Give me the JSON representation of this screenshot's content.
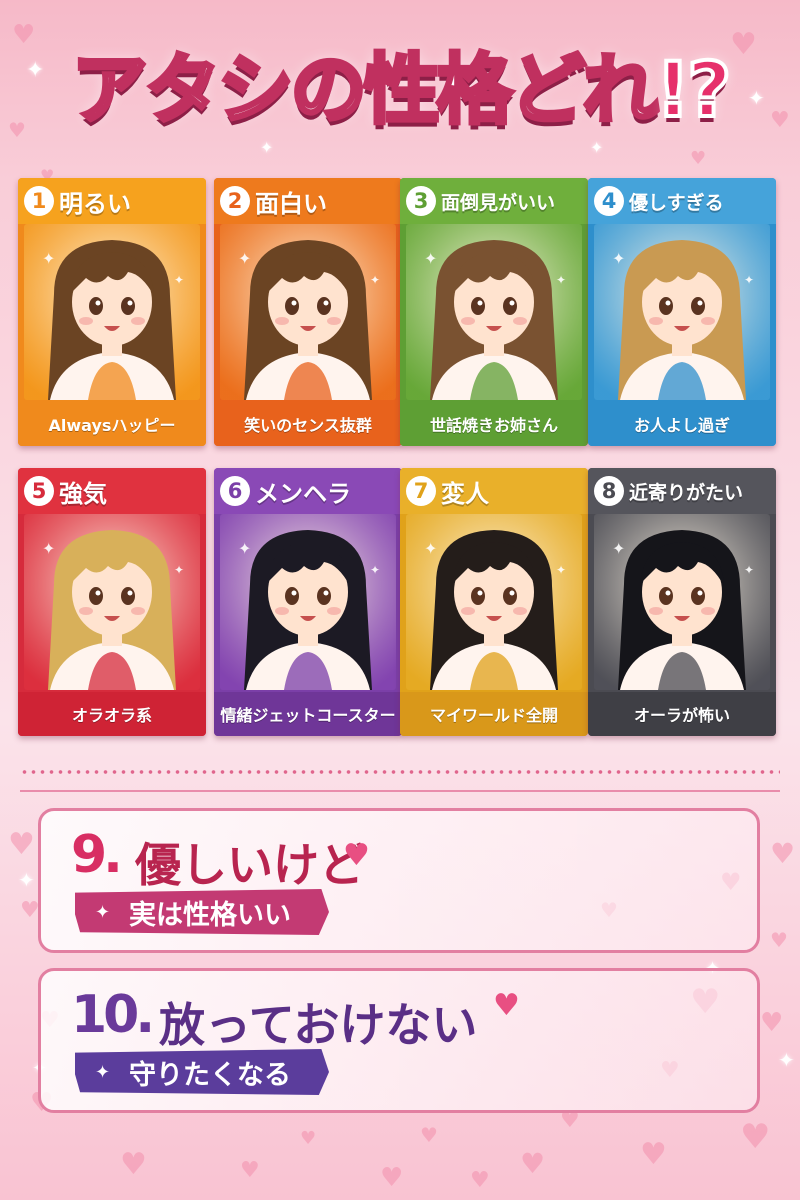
{
  "title": {
    "main": "アタシの性格どれ",
    "mark": "!?"
  },
  "cards": [
    {
      "num": "1",
      "label": "明るい",
      "caption": "Alwaysハッピー",
      "color": "#f08a1c",
      "head": "#f6a21e",
      "foot": "#f08a1c",
      "hair": "#6b4423"
    },
    {
      "num": "2",
      "label": "面白い",
      "caption": "笑いのセンス抜群",
      "color": "#e8621c",
      "head": "#ee7a1d",
      "foot": "#e8621c",
      "hair": "#6b4423"
    },
    {
      "num": "3",
      "label": "面倒見がいい",
      "caption": "世話焼きお姉さん",
      "color": "#5e9f34",
      "head": "#6faf3c",
      "foot": "#5e9f34",
      "hair": "#7a5231"
    },
    {
      "num": "4",
      "label": "優しすぎる",
      "caption": "お人よし過ぎ",
      "color": "#2e8fcc",
      "head": "#45a3da",
      "foot": "#2e8fcc",
      "hair": "#c99a52"
    },
    {
      "num": "5",
      "label": "強気",
      "caption": "オラオラ系",
      "color": "#d62b3c",
      "head": "#e0323f",
      "foot": "#cf2335",
      "hair": "#d8b05a"
    },
    {
      "num": "6",
      "label": "メンヘラ",
      "caption": "情緒ジェットコースター",
      "color": "#7b3fa8",
      "head": "#8a49b6",
      "foot": "#6f3698",
      "hair": "#1c1a24"
    },
    {
      "num": "7",
      "label": "変人",
      "caption": "マイワールド全開",
      "color": "#e0a21a",
      "head": "#e9b02a",
      "foot": "#d9981a",
      "hair": "#241d1a"
    },
    {
      "num": "8",
      "label": "近寄りがたい",
      "caption": "オーラが怖い",
      "color": "#4b4b52",
      "head": "#55555c",
      "foot": "#3f3f45",
      "hair": "#15151a"
    }
  ],
  "panels": [
    {
      "num": "9.",
      "title": "優しいけど",
      "ribbon": "実は性格いい",
      "num_color": "#d82e63",
      "title_color": "#b8244f",
      "ribbon_color": "#c33a73",
      "ribbon_text": "#ffffff"
    },
    {
      "num": "10.",
      "title": "放っておけない",
      "ribbon": "守りたくなる",
      "num_color": "#6a3a9a",
      "title_color": "#5a2f86",
      "ribbon_color": "#5b3d9c",
      "ribbon_text": "#ffffff"
    }
  ]
}
